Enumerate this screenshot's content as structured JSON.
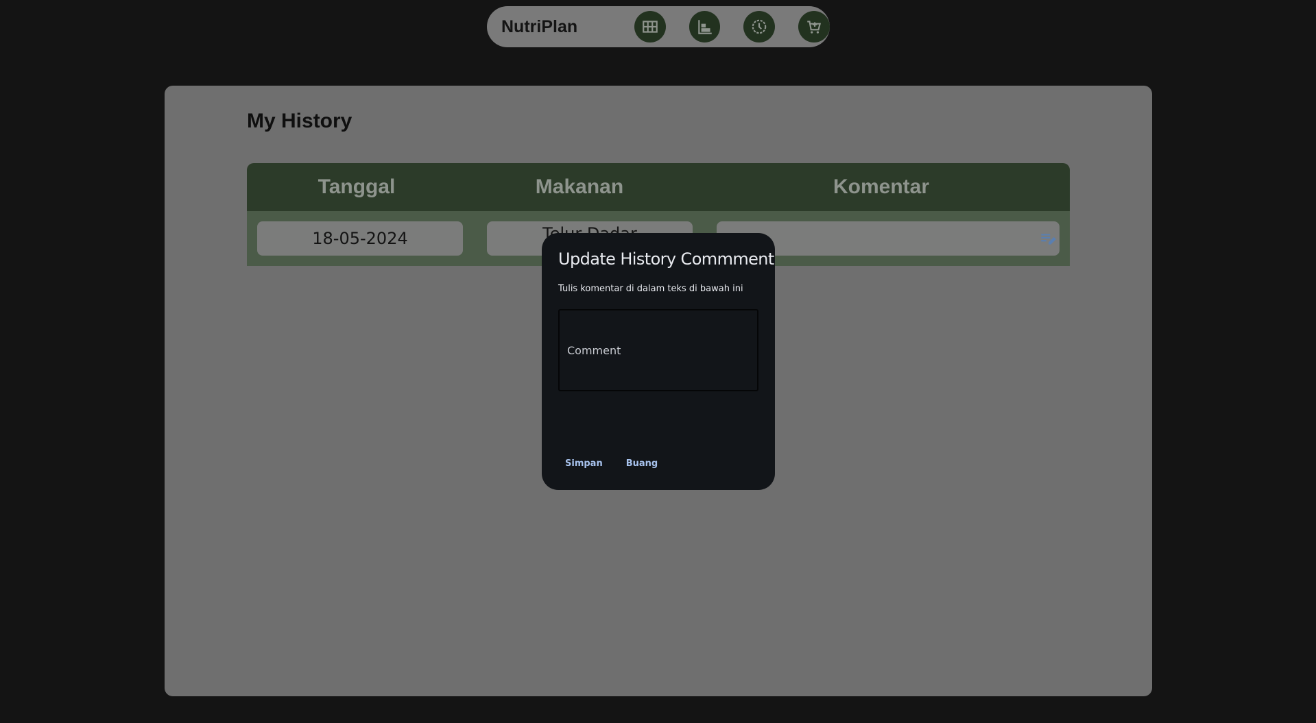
{
  "navbar": {
    "brand": "NutriPlan",
    "items": [
      {
        "icon": "grid-icon"
      },
      {
        "icon": "chart-icon"
      },
      {
        "icon": "clock-icon"
      },
      {
        "icon": "cart-icon"
      }
    ]
  },
  "page": {
    "title": "My History"
  },
  "table": {
    "headers": [
      "Tanggal",
      "Makanan",
      "Komentar"
    ],
    "rows": [
      {
        "date": "18-05-2024",
        "food": "Telur Dadar",
        "comment": ""
      }
    ]
  },
  "dialog": {
    "title": "Update History Commment",
    "subtitle": "Tulis komentar di dalam teks di bawah ini",
    "placeholder": "Comment",
    "save_label": "Simpan",
    "discard_label": "Buang"
  },
  "colors": {
    "background": "#141414",
    "panel": "#6f6f6f",
    "table_header": "#2c3b29",
    "table_row": "#4b5b48",
    "dialog": "#121519",
    "accent": "#a8c3ee"
  }
}
